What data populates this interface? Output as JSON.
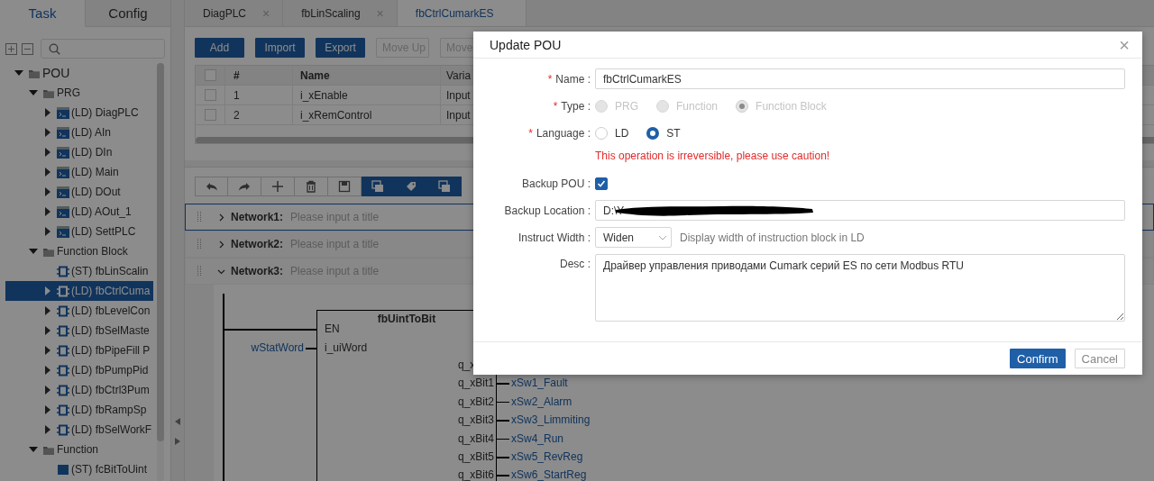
{
  "side_tabs": [
    {
      "label": "Task",
      "selected": true
    },
    {
      "label": "Config",
      "selected": false
    }
  ],
  "tree": [
    {
      "label": "POU",
      "kind": "folder",
      "expandable": true,
      "expanded": true,
      "selected": false,
      "children": [
        {
          "label": "PRG",
          "kind": "folder",
          "expandable": true,
          "expanded": true,
          "selected": false,
          "children": [
            {
              "label": "(LD) DiagPLC",
              "kind": "prg",
              "expandable": true,
              "expanded": false,
              "selected": false
            },
            {
              "label": "(LD) AIn",
              "kind": "prg",
              "expandable": true,
              "expanded": false,
              "selected": false
            },
            {
              "label": "(LD) DIn",
              "kind": "prg",
              "expandable": true,
              "expanded": false,
              "selected": false
            },
            {
              "label": "(LD) Main",
              "kind": "prg",
              "expandable": true,
              "expanded": false,
              "selected": false
            },
            {
              "label": "(LD) DOut",
              "kind": "prg",
              "expandable": true,
              "expanded": false,
              "selected": false
            },
            {
              "label": "(LD) AOut_1",
              "kind": "prg",
              "expandable": true,
              "expanded": false,
              "selected": false
            },
            {
              "label": "(LD) SettPLC",
              "kind": "prg",
              "expandable": true,
              "expanded": false,
              "selected": false
            }
          ]
        },
        {
          "label": "Function Block",
          "kind": "folder",
          "expandable": true,
          "expanded": true,
          "selected": false,
          "children": [
            {
              "label": "(ST) fbLinScalin",
              "kind": "fb",
              "expandable": false,
              "selected": false
            },
            {
              "label": "(LD) fbCtrlCuma",
              "kind": "fb",
              "expandable": true,
              "expanded": false,
              "selected": true
            },
            {
              "label": "(LD) fbLevelCon",
              "kind": "fb",
              "expandable": true,
              "expanded": false,
              "selected": false
            },
            {
              "label": "(LD) fbSelMaste",
              "kind": "fb",
              "expandable": true,
              "expanded": false,
              "selected": false
            },
            {
              "label": "(LD) fbPipeFill P",
              "kind": "fb",
              "expandable": true,
              "expanded": false,
              "selected": false
            },
            {
              "label": "(LD) fbPumpPid",
              "kind": "fb",
              "expandable": true,
              "expanded": false,
              "selected": false
            },
            {
              "label": "(LD) fbCtrl3Pum",
              "kind": "fb",
              "expandable": true,
              "expanded": false,
              "selected": false
            },
            {
              "label": "(LD) fbRampSp",
              "kind": "fb",
              "expandable": true,
              "expanded": false,
              "selected": false
            },
            {
              "label": "(LD) fbSelWorkF",
              "kind": "fb",
              "expandable": true,
              "expanded": false,
              "selected": false
            }
          ]
        },
        {
          "label": "Function",
          "kind": "folder",
          "expandable": true,
          "expanded": true,
          "selected": false,
          "children": [
            {
              "label": "(ST) fcBitToUint",
              "kind": "func",
              "expandable": false,
              "selected": false
            }
          ]
        }
      ]
    }
  ],
  "editor_tabs": [
    {
      "label": "DiagPLC",
      "selected": false,
      "close": "×"
    },
    {
      "label": "fbLinScaling",
      "selected": false,
      "close": "×"
    },
    {
      "label": "fbCtrlCumarkES",
      "selected": true
    }
  ],
  "var_buttons": [
    {
      "label": "Add",
      "disabled": false
    },
    {
      "label": "Import",
      "disabled": false
    },
    {
      "label": "Export",
      "disabled": false
    },
    {
      "label": "Move Up",
      "disabled": true
    },
    {
      "label": "Move",
      "disabled": true
    }
  ],
  "var_table": {
    "header_checked": false,
    "columns": [
      "#",
      "Name",
      "Varia"
    ],
    "rows": [
      {
        "checked": false,
        "cells": [
          "1",
          "i_xEnable",
          "Input"
        ]
      },
      {
        "checked": false,
        "cells": [
          "2",
          "i_xRemControl",
          "Input"
        ]
      }
    ]
  },
  "ladder_toolbar": [
    {
      "accent": false
    },
    {
      "accent": false
    },
    {
      "accent": false
    },
    {
      "accent": false
    },
    {
      "accent": false
    },
    {
      "accent": true
    },
    {
      "accent": true
    },
    {
      "accent": true
    }
  ],
  "networks": [
    {
      "label": "Network1:",
      "placeholder": "Please input a title",
      "expanded": false,
      "selected": true
    },
    {
      "label": "Network2:",
      "placeholder": "Please input a title",
      "expanded": false,
      "selected": false
    },
    {
      "label": "Network3:",
      "placeholder": "Please input a title",
      "expanded": true,
      "selected": false
    }
  ],
  "diagram": {
    "block_title": "fbUintToBit",
    "inputs": [
      {
        "pin": "EN"
      },
      {
        "pin": "i_uiWord",
        "variable": "wStatWord"
      }
    ],
    "outputs": [
      {
        "pin": "q_x"
      },
      {
        "pin": "q_xBit1",
        "variable": "xSw1_Fault"
      },
      {
        "pin": "q_xBit2",
        "variable": "xSw2_Alarm"
      },
      {
        "pin": "q_xBit3",
        "variable": "xSw3_Limmiting"
      },
      {
        "pin": "q_xBit4",
        "variable": "xSw4_Run"
      },
      {
        "pin": "q_xBit5",
        "variable": "xSw5_RevReg"
      },
      {
        "pin": "q_xBit6",
        "variable": "xSw6_StartReg"
      }
    ]
  },
  "dialog": {
    "title": "Update POU",
    "close": "×",
    "fields": [
      {
        "kind": "text",
        "required_mark": "*",
        "label": "Name :",
        "value": "fbCtrlCumarkES"
      },
      {
        "kind": "radio",
        "required_mark": "*",
        "label": "Type :",
        "disabled": true,
        "options": [
          {
            "label": "PRG",
            "selected": false
          },
          {
            "label": "Function",
            "selected": false
          },
          {
            "label": "Function Block",
            "selected": true
          }
        ]
      },
      {
        "kind": "radio",
        "required_mark": "*",
        "label": "Language :",
        "disabled": false,
        "options": [
          {
            "label": "LD",
            "selected": false
          },
          {
            "label": "ST",
            "selected": true
          }
        ]
      },
      {
        "kind": "warning",
        "text": "This operation is irreversible, please use caution!"
      },
      {
        "kind": "checkbox",
        "label": "Backup POU :",
        "checked": true
      },
      {
        "kind": "text",
        "label": "Backup Location :",
        "value": "D:\\Y",
        "redacted": true
      },
      {
        "kind": "select",
        "label": "Instruct Width :",
        "value": "Widen",
        "hint": "Display width of instruction block in LD"
      },
      {
        "kind": "textarea",
        "label": "Desc :",
        "value": "Драйвер управления приводами Cumark серий ES по сети Modbus RTU"
      }
    ],
    "buttons": [
      {
        "label": "Confirm",
        "primary": true
      },
      {
        "label": "Cancel",
        "primary": false
      }
    ]
  }
}
